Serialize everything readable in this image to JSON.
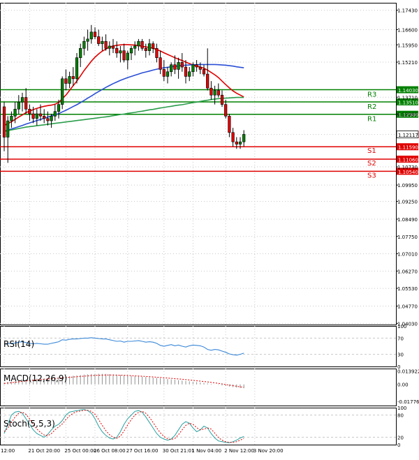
{
  "colors": {
    "resistance": "#008000",
    "support": "#e00000",
    "ma_fast": "#e00000",
    "ma_mid": "#2a4fd6",
    "ma_slow": "#2a9d4a",
    "candle_bull": "#008000",
    "candle_bear": "#e00000",
    "rsi": "#3a88d8",
    "macd_hist": "#909090",
    "macd_signal": "#e00000",
    "stoch_main": "#2aa0a0",
    "stoch_signal": "#e00000",
    "grid": "#c8c8c8"
  },
  "chart_data": [
    {
      "type": "candlestick",
      "panel": "price",
      "ylim": [
        1.0398,
        1.1775
      ],
      "y_ticks": [
        "1.17430",
        "1.16600",
        "1.15950",
        "1.15210",
        "1.13710",
        "1.12980",
        "1.12117",
        "1.10730",
        "1.09950",
        "1.09250",
        "1.08490",
        "1.07750",
        "1.07010",
        "1.06270",
        "1.05530",
        "1.04770",
        "1.04030"
      ],
      "y_tick_values": [
        1.1743,
        1.166,
        1.1595,
        1.1521,
        1.1371,
        1.1298,
        1.12117,
        1.1073,
        1.0995,
        1.0925,
        1.0849,
        1.0775,
        1.0701,
        1.0627,
        1.0553,
        1.0477,
        1.0403
      ],
      "x_labels": [
        "12:00",
        "21 Oct 20:00",
        "25 Oct 00:00",
        "26 Oct 08:00",
        "27 Oct 16:00",
        "30 Oct 21:01",
        "1 Nov 04:00",
        "2 Nov 12:00",
        "3 Nov 20:00"
      ],
      "x_label_index": [
        0,
        7,
        17,
        25,
        34,
        44,
        52,
        61,
        69
      ],
      "current_price": "1.12117",
      "current_value": 1.12117,
      "candles": [
        [
          1.133,
          1.135,
          1.114,
          1.12
        ],
        [
          1.12,
          1.129,
          1.109,
          1.127
        ],
        [
          1.127,
          1.131,
          1.124,
          1.129
        ],
        [
          1.129,
          1.135,
          1.126,
          1.132
        ],
        [
          1.132,
          1.138,
          1.13,
          1.135
        ],
        [
          1.135,
          1.139,
          1.131,
          1.137
        ],
        [
          1.137,
          1.141,
          1.13,
          1.132
        ],
        [
          1.132,
          1.134,
          1.127,
          1.13
        ],
        [
          1.13,
          1.133,
          1.126,
          1.128
        ],
        [
          1.128,
          1.132,
          1.125,
          1.13
        ],
        [
          1.13,
          1.134,
          1.127,
          1.129
        ],
        [
          1.129,
          1.132,
          1.126,
          1.128
        ],
        [
          1.128,
          1.131,
          1.125,
          1.127
        ],
        [
          1.127,
          1.13,
          1.124,
          1.129
        ],
        [
          1.129,
          1.134,
          1.127,
          1.131
        ],
        [
          1.131,
          1.136,
          1.128,
          1.134
        ],
        [
          1.134,
          1.146,
          1.132,
          1.145
        ],
        [
          1.145,
          1.149,
          1.14,
          1.143
        ],
        [
          1.143,
          1.148,
          1.141,
          1.146
        ],
        [
          1.146,
          1.15,
          1.142,
          1.145
        ],
        [
          1.145,
          1.156,
          1.143,
          1.154
        ],
        [
          1.154,
          1.16,
          1.15,
          1.158
        ],
        [
          1.158,
          1.163,
          1.155,
          1.161
        ],
        [
          1.161,
          1.166,
          1.157,
          1.162
        ],
        [
          1.162,
          1.168,
          1.16,
          1.165
        ],
        [
          1.165,
          1.167,
          1.162,
          1.163
        ],
        [
          1.163,
          1.166,
          1.159,
          1.16
        ],
        [
          1.16,
          1.163,
          1.157,
          1.161
        ],
        [
          1.161,
          1.164,
          1.157,
          1.158
        ],
        [
          1.158,
          1.161,
          1.155,
          1.159
        ],
        [
          1.159,
          1.162,
          1.156,
          1.158
        ],
        [
          1.158,
          1.161,
          1.154,
          1.156
        ],
        [
          1.156,
          1.159,
          1.152,
          1.157
        ],
        [
          1.157,
          1.16,
          1.152,
          1.153
        ],
        [
          1.153,
          1.157,
          1.149,
          1.156
        ],
        [
          1.156,
          1.159,
          1.153,
          1.158
        ],
        [
          1.158,
          1.161,
          1.155,
          1.159
        ],
        [
          1.159,
          1.162,
          1.157,
          1.161
        ],
        [
          1.161,
          1.162,
          1.157,
          1.158
        ],
        [
          1.158,
          1.16,
          1.154,
          1.157
        ],
        [
          1.157,
          1.162,
          1.155,
          1.16
        ],
        [
          1.16,
          1.161,
          1.156,
          1.158
        ],
        [
          1.158,
          1.16,
          1.152,
          1.154
        ],
        [
          1.154,
          1.157,
          1.147,
          1.149
        ],
        [
          1.149,
          1.153,
          1.144,
          1.146
        ],
        [
          1.146,
          1.15,
          1.143,
          1.148
        ],
        [
          1.148,
          1.152,
          1.146,
          1.151
        ],
        [
          1.151,
          1.155,
          1.147,
          1.149
        ],
        [
          1.149,
          1.154,
          1.145,
          1.152
        ],
        [
          1.152,
          1.156,
          1.148,
          1.15
        ],
        [
          1.15,
          1.153,
          1.143,
          1.146
        ],
        [
          1.146,
          1.15,
          1.144,
          1.148
        ],
        [
          1.148,
          1.152,
          1.146,
          1.151
        ],
        [
          1.151,
          1.153,
          1.148,
          1.15
        ],
        [
          1.15,
          1.152,
          1.147,
          1.149
        ],
        [
          1.149,
          1.151,
          1.146,
          1.147
        ],
        [
          1.147,
          1.158,
          1.14,
          1.141
        ],
        [
          1.141,
          1.144,
          1.136,
          1.138
        ],
        [
          1.138,
          1.142,
          1.134,
          1.14
        ],
        [
          1.14,
          1.143,
          1.137,
          1.138
        ],
        [
          1.138,
          1.14,
          1.133,
          1.134
        ],
        [
          1.134,
          1.136,
          1.128,
          1.129
        ],
        [
          1.129,
          1.13,
          1.12,
          1.122
        ],
        [
          1.122,
          1.124,
          1.116,
          1.118
        ],
        [
          1.118,
          1.12,
          1.115,
          1.117
        ],
        [
          1.117,
          1.12,
          1.115,
          1.118
        ],
        [
          1.118,
          1.123,
          1.116,
          1.1212
        ]
      ],
      "moving_averages": [
        {
          "color_key": "ma_fast",
          "values": [
            1.125,
            1.1258,
            1.1266,
            1.1276,
            1.1286,
            1.1295,
            1.1305,
            1.1311,
            1.1318,
            1.1323,
            1.1328,
            1.1332,
            1.1335,
            1.1337,
            1.1341,
            1.1348,
            1.1365,
            1.138,
            1.14,
            1.142,
            1.144,
            1.1462,
            1.1485,
            1.1505,
            1.1525,
            1.1542,
            1.1556,
            1.1568,
            1.1577,
            1.1585,
            1.159,
            1.1593,
            1.1595,
            1.1596,
            1.1596,
            1.1595,
            1.1594,
            1.1592,
            1.1589,
            1.1586,
            1.1584,
            1.158,
            1.1575,
            1.1569,
            1.1561,
            1.1554,
            1.1547,
            1.154,
            1.1534,
            1.1528,
            1.1521,
            1.1515,
            1.1509,
            1.1504,
            1.15,
            1.1495,
            1.1487,
            1.1477,
            1.1467,
            1.1455,
            1.144,
            1.1425,
            1.1411,
            1.1398,
            1.1388,
            1.138,
            1.1372
          ]
        },
        {
          "color_key": "ma_mid",
          "values": [
            1.1225,
            1.123,
            1.1235,
            1.124,
            1.1245,
            1.125,
            1.1256,
            1.1261,
            1.1266,
            1.1271,
            1.1276,
            1.1281,
            1.1286,
            1.1291,
            1.1296,
            1.1301,
            1.1308,
            1.1315,
            1.1323,
            1.1331,
            1.1339,
            1.1348,
            1.1357,
            1.1367,
            1.1376,
            1.1386,
            1.1395,
            1.1404,
            1.1413,
            1.1421,
            1.1429,
            1.1436,
            1.1443,
            1.1449,
            1.1455,
            1.146,
            1.1465,
            1.147,
            1.1475,
            1.1479,
            1.1483,
            1.1487,
            1.1491,
            1.1494,
            1.1497,
            1.1499,
            1.1501,
            1.1503,
            1.1505,
            1.1507,
            1.1508,
            1.1509,
            1.151,
            1.151,
            1.1511,
            1.1511,
            1.1511,
            1.1511,
            1.1511,
            1.151,
            1.1509,
            1.1508,
            1.1506,
            1.1504,
            1.1501,
            1.1499,
            1.1497
          ]
        },
        {
          "color_key": "ma_slow",
          "values": [
            1.1225,
            1.1228,
            1.1231,
            1.1234,
            1.1237,
            1.124,
            1.1243,
            1.1245,
            1.1247,
            1.1249,
            1.1251,
            1.1253,
            1.1255,
            1.1257,
            1.1259,
            1.1261,
            1.1263,
            1.1265,
            1.1267,
            1.1269,
            1.1271,
            1.1273,
            1.1275,
            1.1277,
            1.1279,
            1.1281,
            1.1283,
            1.1285,
            1.1287,
            1.1289,
            1.1292,
            1.1294,
            1.1297,
            1.1299,
            1.1302,
            1.1304,
            1.1306,
            1.1309,
            1.1311,
            1.1314,
            1.1317,
            1.1319,
            1.1322,
            1.1325,
            1.1327,
            1.133,
            1.1332,
            1.1335,
            1.1337,
            1.1339,
            1.1342,
            1.1345,
            1.1348,
            1.135,
            1.1353,
            1.1356,
            1.1358,
            1.1361,
            1.1363,
            1.1365,
            1.1366,
            1.1367,
            1.1368,
            1.1369,
            1.137,
            1.137,
            1.137
          ]
        }
      ],
      "levels": [
        {
          "label": "R3",
          "value": "1.14030",
          "y": 1.1403,
          "color_key": "resistance"
        },
        {
          "label": "R2",
          "value": "1.13510",
          "y": 1.1351,
          "color_key": "resistance"
        },
        {
          "label": "R1",
          "value": "1.12980",
          "y": 1.1298,
          "color_key": "resistance"
        },
        {
          "label": "S1",
          "value": "1.11590",
          "y": 1.1159,
          "color_key": "support"
        },
        {
          "label": "S2",
          "value": "1.11060",
          "y": 1.1106,
          "color_key": "support"
        },
        {
          "label": "S3",
          "value": "1.10540",
          "y": 1.1054,
          "color_key": "support"
        }
      ]
    },
    {
      "type": "line",
      "panel": "rsi",
      "title": "RSI(14)",
      "ylim": [
        0,
        100
      ],
      "y_ticks": [
        "100",
        "70",
        "30",
        "0"
      ],
      "y_tick_values": [
        100,
        70,
        30,
        0
      ],
      "values": [
        55,
        56,
        57,
        58,
        60,
        61,
        59,
        57,
        56,
        57,
        56,
        55,
        55,
        57,
        59,
        61,
        66,
        65,
        67,
        68,
        68,
        69,
        70,
        70,
        71,
        70,
        69,
        68,
        68,
        66,
        64,
        62,
        63,
        60,
        62,
        62,
        63,
        64,
        62,
        60,
        61,
        60,
        57,
        52,
        50,
        52,
        54,
        51,
        53,
        50,
        48,
        51,
        53,
        52,
        51,
        48,
        42,
        40,
        42,
        41,
        38,
        35,
        31,
        29,
        28,
        30,
        33
      ]
    },
    {
      "type": "bar+line",
      "panel": "macd",
      "title": "MACD(12,26,9)",
      "ylim": [
        -0.022,
        0.0165
      ],
      "y_ticks": [
        "0.013922",
        "0.00",
        "-0.01776"
      ],
      "y_tick_values": [
        0.013922,
        0,
        -0.01776
      ],
      "histogram": [
        0.002,
        0.0025,
        0.003,
        0.0036,
        0.0042,
        0.0048,
        0.0052,
        0.0055,
        0.0058,
        0.006,
        0.0062,
        0.0064,
        0.0066,
        0.0068,
        0.007,
        0.0073,
        0.0078,
        0.0082,
        0.0086,
        0.009,
        0.0094,
        0.0098,
        0.0102,
        0.0105,
        0.0108,
        0.011,
        0.0111,
        0.011,
        0.0109,
        0.0107,
        0.0105,
        0.0102,
        0.0099,
        0.0096,
        0.0093,
        0.009,
        0.0087,
        0.0084,
        0.0081,
        0.0078,
        0.0075,
        0.0072,
        0.0068,
        0.0064,
        0.006,
        0.0056,
        0.0052,
        0.0048,
        0.0044,
        0.004,
        0.0036,
        0.0032,
        0.0028,
        0.0024,
        0.002,
        0.0016,
        0.0011,
        0.0006,
        0.0001,
        -0.0004,
        -0.001,
        -0.0016,
        -0.0022,
        -0.0028,
        -0.0033,
        -0.0037,
        -0.004
      ],
      "signal": [
        0.001,
        0.0014,
        0.0018,
        0.0022,
        0.0027,
        0.0032,
        0.0036,
        0.004,
        0.0044,
        0.0047,
        0.005,
        0.0053,
        0.0056,
        0.0059,
        0.0062,
        0.0065,
        0.0068,
        0.0071,
        0.0074,
        0.0077,
        0.008,
        0.0083,
        0.0086,
        0.0089,
        0.0092,
        0.0094,
        0.0096,
        0.0097,
        0.0098,
        0.0098,
        0.0098,
        0.0097,
        0.0096,
        0.0095,
        0.0093,
        0.0091,
        0.0089,
        0.0087,
        0.0085,
        0.0083,
        0.0081,
        0.0078,
        0.0075,
        0.0072,
        0.0069,
        0.0066,
        0.0063,
        0.006,
        0.0057,
        0.0054,
        0.005,
        0.0046,
        0.0042,
        0.0038,
        0.0034,
        0.003,
        0.0026,
        0.0021,
        0.0016,
        0.0011,
        0.0005,
        -0.0001,
        -0.0007,
        -0.0013,
        -0.0019,
        -0.0025,
        -0.003
      ]
    },
    {
      "type": "line",
      "panel": "stoch",
      "title": "Stoch(5,5,3)",
      "ylim": [
        0,
        100
      ],
      "y_ticks": [
        "100",
        "80",
        "20",
        "0"
      ],
      "y_tick_values": [
        100,
        80,
        20,
        0
      ],
      "main": [
        30,
        55,
        80,
        88,
        90,
        85,
        70,
        55,
        40,
        30,
        25,
        20,
        28,
        40,
        50,
        55,
        65,
        80,
        88,
        90,
        92,
        94,
        95,
        92,
        85,
        70,
        50,
        35,
        25,
        18,
        15,
        20,
        35,
        55,
        70,
        80,
        90,
        92,
        88,
        75,
        60,
        45,
        30,
        20,
        15,
        12,
        15,
        25,
        40,
        55,
        62,
        58,
        45,
        35,
        40,
        50,
        45,
        30,
        18,
        10,
        8,
        6,
        5,
        8,
        12,
        18,
        22
      ],
      "signal": [
        35,
        45,
        60,
        75,
        85,
        88,
        82,
        70,
        55,
        42,
        33,
        26,
        24,
        30,
        40,
        48,
        56,
        68,
        78,
        85,
        89,
        91,
        93,
        93,
        90,
        82,
        68,
        52,
        38,
        27,
        20,
        17,
        23,
        37,
        53,
        68,
        80,
        87,
        90,
        85,
        74,
        60,
        45,
        32,
        22,
        16,
        14,
        17,
        27,
        40,
        52,
        58,
        55,
        46,
        40,
        42,
        45,
        42,
        31,
        19,
        12,
        8,
        6,
        6,
        8,
        12,
        17
      ]
    }
  ]
}
